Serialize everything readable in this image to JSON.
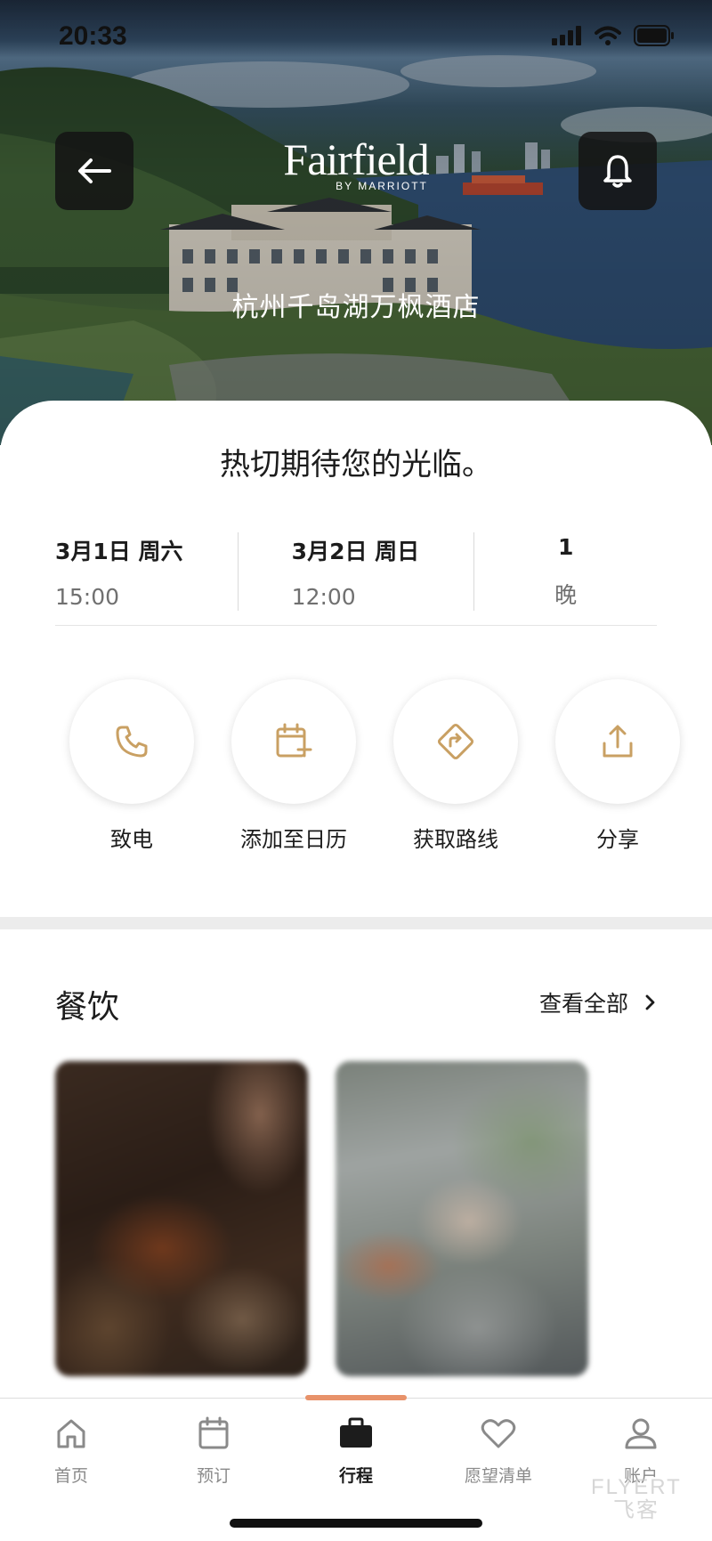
{
  "status_bar": {
    "time": "20:33"
  },
  "header": {
    "brand_name": "Fairfield",
    "brand_sub": "BY MARRIOTT",
    "hotel_name": "杭州千岛湖万枫酒店",
    "back_icon": "arrow-left-icon",
    "bell_icon": "bell-icon"
  },
  "stay": {
    "welcome": "热切期待您的光临。",
    "checkin": {
      "date": "3月1日 周六",
      "time": "15:00"
    },
    "checkout": {
      "date": "3月2日 周日",
      "time": "12:00"
    },
    "nights": {
      "count": "1",
      "unit": "晚"
    }
  },
  "actions": [
    {
      "label": "致电",
      "icon": "phone-icon"
    },
    {
      "label": "添加至日历",
      "icon": "calendar-add-icon"
    },
    {
      "label": "获取路线",
      "icon": "directions-icon"
    },
    {
      "label": "分享",
      "icon": "share-icon"
    }
  ],
  "dining": {
    "title": "餐饮",
    "view_all": "查看全部"
  },
  "tabs": [
    {
      "label": "首页",
      "icon": "home-icon",
      "active": false
    },
    {
      "label": "预订",
      "icon": "calendar-icon",
      "active": false
    },
    {
      "label": "行程",
      "icon": "briefcase-icon",
      "active": true
    },
    {
      "label": "愿望清单",
      "icon": "heart-icon",
      "active": false
    },
    {
      "label": "账户",
      "icon": "user-icon",
      "active": false
    }
  ],
  "watermark": {
    "line1": "FLYERT",
    "line2": "飞客"
  },
  "colors": {
    "accent": "#c9a063",
    "tab_indicator": "#e8926a",
    "active_tab": "#1c1c1c"
  }
}
